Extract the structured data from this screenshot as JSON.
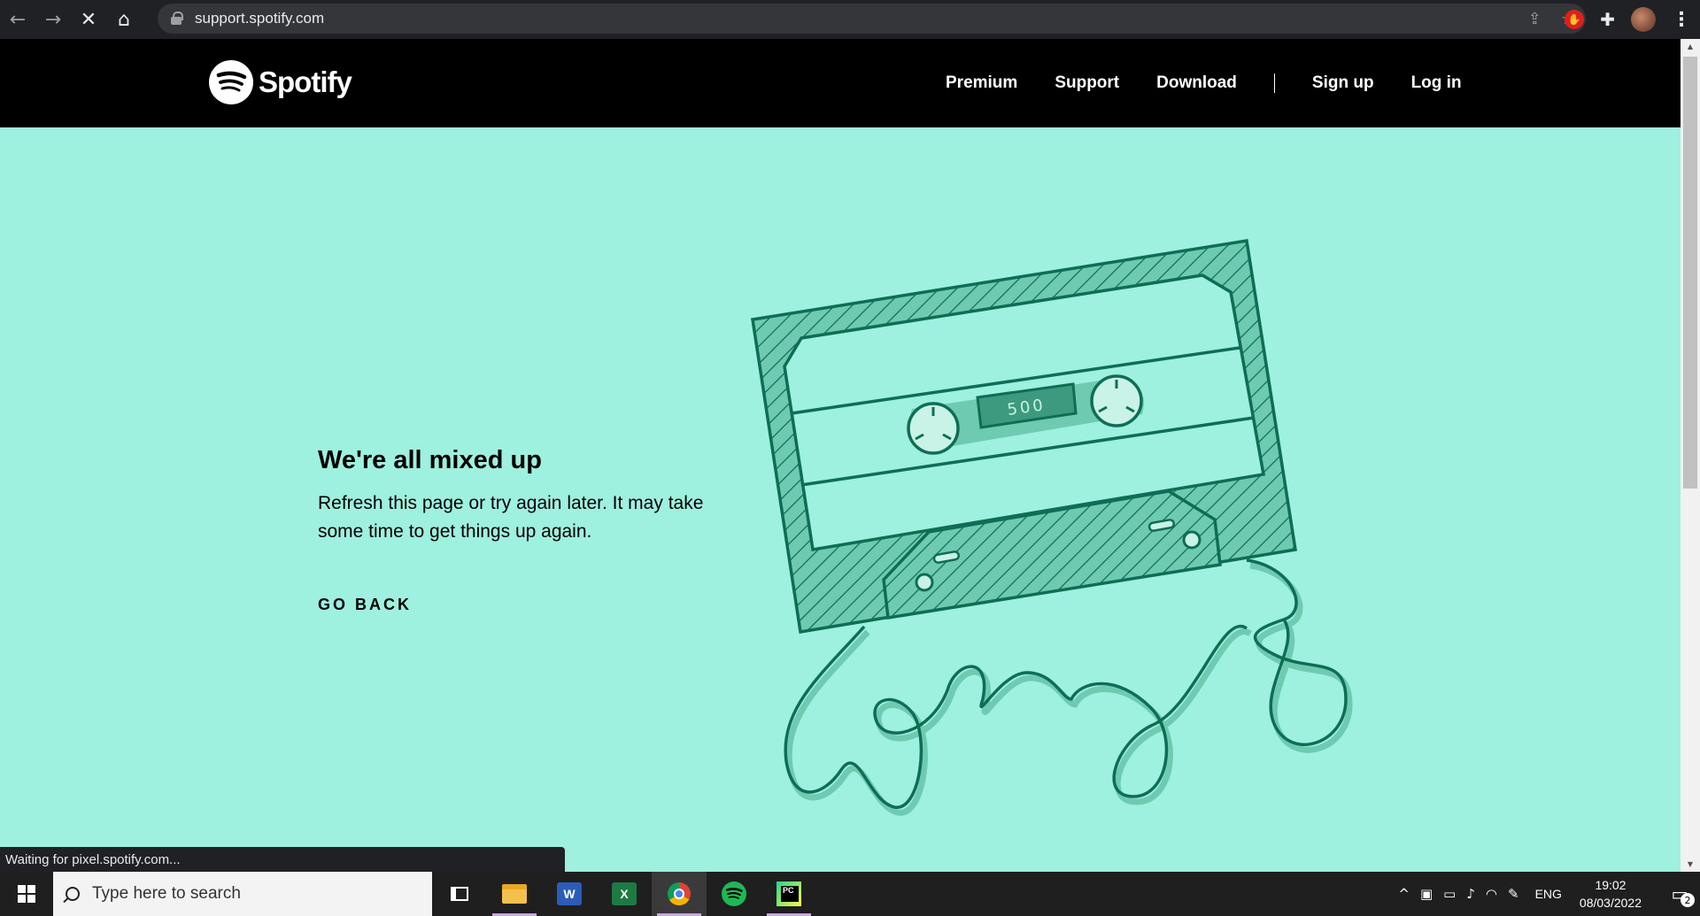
{
  "browser": {
    "url": "support.spotify.com",
    "back_glyph": "←",
    "forward_glyph": "→",
    "stop_glyph": "✕",
    "home_glyph": "⌂",
    "share_glyph": "⇪",
    "bookmark_glyph": "☆",
    "extension_glyph": "✋",
    "puzzle_glyph": "✚",
    "menu_glyph": "⋮",
    "status_text": "Waiting for pixel.spotify.com..."
  },
  "site": {
    "logo_text": "Spotify",
    "nav": {
      "premium": "Premium",
      "support": "Support",
      "download": "Download",
      "signup": "Sign up",
      "login": "Log in"
    },
    "colors": {
      "header_bg": "#000000",
      "page_bg": "#9ef0df",
      "illustration": "#0e6e55"
    }
  },
  "error": {
    "title": "We're all mixed up",
    "description": "Refresh this page or try again later. It may take some time to get things up again.",
    "go_back": "GO BACK",
    "code": "500"
  },
  "taskbar": {
    "search_placeholder": "Type here to search",
    "apps": [
      "task-view",
      "file-explorer",
      "word",
      "excel",
      "chrome",
      "spotify",
      "pycharm"
    ],
    "word_letter": "W",
    "excel_letter": "X",
    "tray_chevron": "^",
    "language": "ENG",
    "time": "19:02",
    "date": "08/03/2022",
    "notification_count": "2",
    "notification_glyph": "▭"
  },
  "scrollbar": {
    "up_glyph": "▲",
    "down_glyph": "▼"
  }
}
